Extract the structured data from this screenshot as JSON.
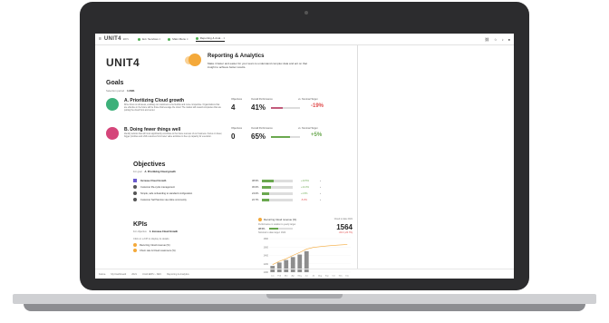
{
  "topbar": {
    "menu_icon": "hamburger-icon",
    "brand": "UNIT4",
    "brand_sub": "ERPx",
    "tabs": [
      {
        "label": "Ext. Services ×",
        "active": false
      },
      {
        "label": "Main Menu ×",
        "active": false
      },
      {
        "label": "Reporting & Anal... ×",
        "active": true
      }
    ],
    "right_icons": [
      "link-icon",
      "star-icon",
      "bell-icon",
      "user-icon"
    ]
  },
  "header": {
    "logo": "UNIT4",
    "title": "Reporting & Analytics",
    "description": "Make it faster and easier for your team to understand complex data and act on that insight to achieve better results."
  },
  "goals": {
    "heading": "Goals",
    "period_label": "Selection period",
    "period_value": "1 2021",
    "columns": {
      "objectives": "Objectives",
      "performance": "Overall Performance",
      "target": "vs. Nominal Target"
    },
    "items": [
      {
        "title": "A. Prioritizing Cloud growth",
        "description": "Drive focus on all areas, enabling our customers to be flexible and more competitive. Organizations that are effective in the future will be those that leverage the cloud. The market will reward companies that are putting the cloud front and center.",
        "objectives": "4",
        "performance": "41%",
        "performance_fraction": 0.41,
        "delta": "-19%",
        "color": "#3db07a"
      },
      {
        "title": "B. Doing fewer things well",
        "description": "Identify actions that will most significantly contribute to the future success of our business. Focus on fewer, bigger priorities and shift resources from lower value activities to free up capacity for execution.",
        "objectives": "0",
        "performance": "65%",
        "performance_fraction": 0.65,
        "delta": "+5%",
        "color": "#d5457a"
      }
    ]
  },
  "objectives": {
    "heading": "Objectives",
    "for_goal_label": "For goal",
    "for_goal_value": "A. Prioritizing Cloud growth",
    "rows": [
      {
        "label": "Increase Cloud Growth",
        "pct": "38.5%",
        "fraction": 0.385,
        "delta": "+10.5%",
        "neg": false,
        "icon": "square-icon"
      },
      {
        "label": "Customer life-cycle management",
        "pct": "30.0%",
        "fraction": 0.3,
        "delta": "+14.3%",
        "neg": false,
        "icon": "circle-icon"
      },
      {
        "label": "Simple, safe onboarding to standard configuration",
        "pct": "24.0%",
        "fraction": 0.24,
        "delta": "+1.5%",
        "neg": false,
        "icon": "circle-icon"
      },
      {
        "label": "Customer Self Service via online community",
        "pct": "22.7%",
        "fraction": 0.227,
        "delta": "-5.3%",
        "neg": true,
        "icon": "circle-icon"
      }
    ]
  },
  "kpis": {
    "heading": "KPIs",
    "for_objective_label": "For objective",
    "for_objective_value": "1. Increase Cloud Growth",
    "click_hint": "Click on a KPI to display its details",
    "items": [
      "Recurring Cloud revenue (%)",
      "Churn rate & Cloud customers (%)"
    ],
    "card": {
      "title": "Recurring Cloud revenue (%)",
      "right": "Cloud to date 2021",
      "sub": "Performance in relation to yearly target",
      "pct": "38.5%",
      "fraction": 0.385,
      "big_value": "1564",
      "delta_label": "Nominal to date target:",
      "delta_target": "1624",
      "delta": "-60.0 (-20.7%)"
    }
  },
  "chart_data": {
    "type": "bar",
    "categories": [
      "Jan",
      "Feb",
      "Mar",
      "Apr",
      "May",
      "Jun",
      "Jul",
      "Aug",
      "Sep",
      "Oct",
      "Nov",
      "Dec"
    ],
    "series": [
      {
        "values": [
          1150,
          1230,
          1290,
          1360,
          1420,
          1500,
          null,
          null,
          null,
          null,
          null,
          null
        ]
      },
      {
        "values": [
          1180,
          1260,
          1320,
          1400,
          1470,
          1550,
          1590,
          1610,
          1625,
          1640,
          1650,
          1660
        ]
      }
    ],
    "y_ticks": [
      "1000",
      "1200",
      "1400",
      "1600",
      "1800"
    ],
    "ylim": [
      1000,
      1800
    ],
    "colors": {
      "bars": "#8e8e8e",
      "line": "#f4a93a"
    }
  },
  "statusbar": {
    "items": [
      "Fatma",
      "My Dashboard",
      "2021",
      "Unit4 ERPx - DEV",
      "Reporting & Analytics"
    ]
  }
}
